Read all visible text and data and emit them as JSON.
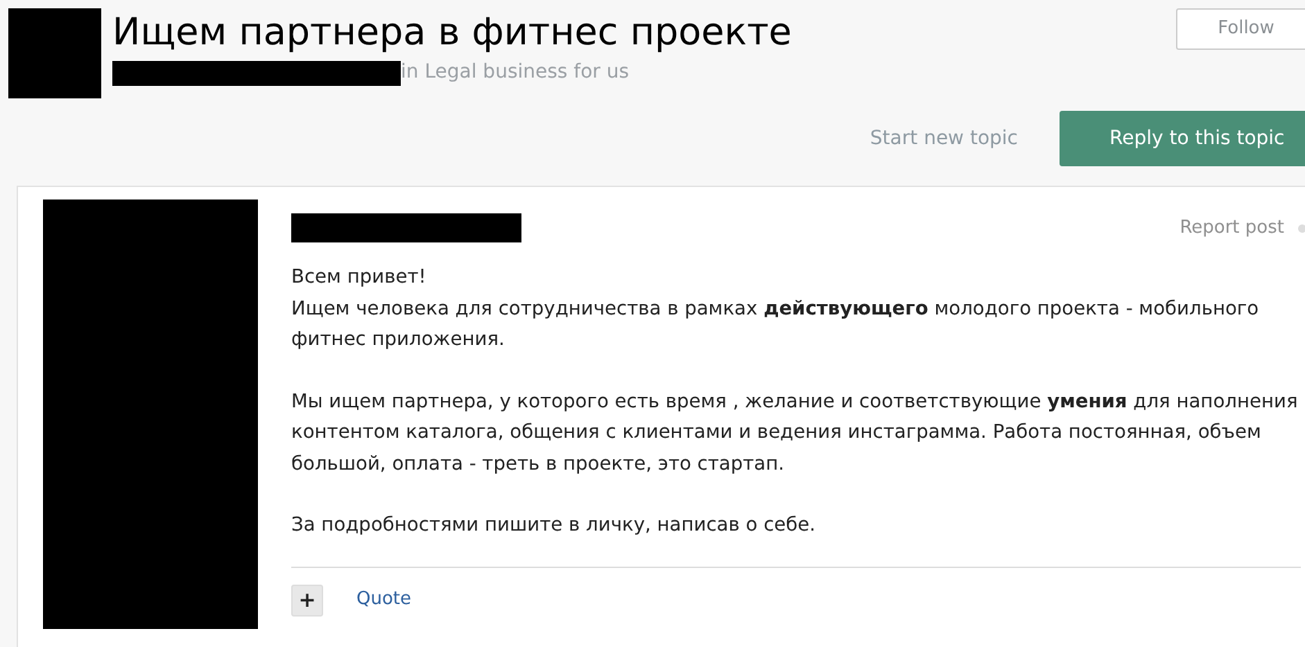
{
  "topic": {
    "title": "Ищем партнера в фитнес проекте",
    "forum_line": "in Legal business for us"
  },
  "follow_button": "Follow",
  "actions": {
    "start_topic": "Start new topic",
    "reply": "Reply to this topic"
  },
  "post": {
    "report": "Report post",
    "paragraphs": [
      "Всем привет!\nИщем человека для сотрудничества в рамках **действующего** молодого проекта -  мобильного фитнес приложения.",
      "Мы ищем партнера, у которого есть время , желание и соответствующие **умения** для наполнения контентом каталога, общения с клиентами и ведения инстаграмма. Работа постоянная, объем большой, оплата - треть в проекте, это стартап.",
      "За подробностями пишите в личку, написав о себе."
    ],
    "plus_button": "+",
    "quote": "Quote"
  }
}
